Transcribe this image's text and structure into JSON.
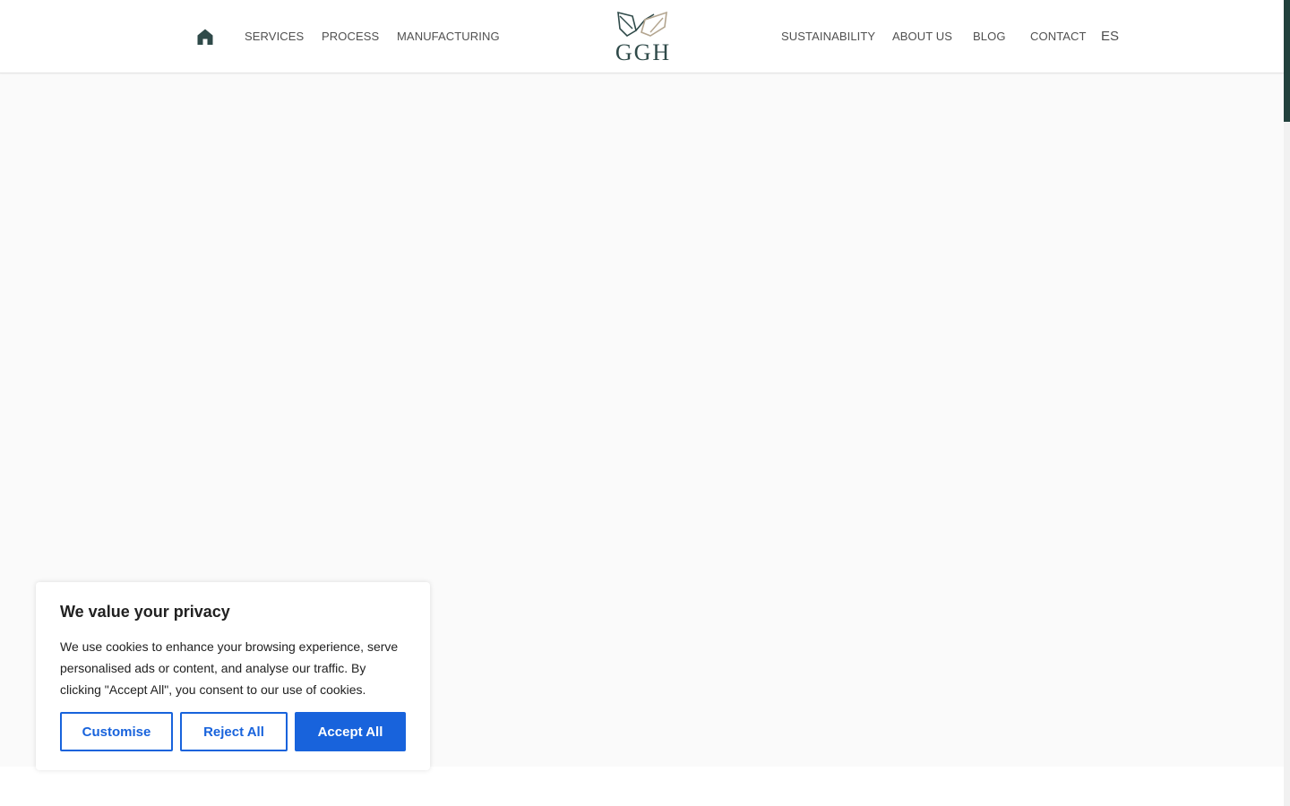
{
  "header": {
    "nav_left": [
      {
        "label": "SERVICES"
      },
      {
        "label": "PROCESS"
      },
      {
        "label": "MANUFACTURING"
      }
    ],
    "logo_text": "GGH",
    "nav_right": [
      {
        "label": "SUSTAINABILITY"
      },
      {
        "label": "ABOUT US"
      },
      {
        "label": "BLOG"
      },
      {
        "label": "CONTACT"
      }
    ],
    "language": "ES"
  },
  "icons": {
    "home": "home-icon",
    "logo": "leaf-logo-icon"
  },
  "cookie_banner": {
    "title": "We value your privacy",
    "text": "We use cookies to enhance your browsing experience, serve personalised ads or content, and analyse our traffic. By clicking \"Accept All\", you consent to our use of cookies.",
    "buttons": {
      "customise": "Customise",
      "reject": "Reject All",
      "accept": "Accept All"
    }
  },
  "colors": {
    "brand_dark": "#2f4a49",
    "logo_accent": "#b3a58f",
    "cookie_accent": "#1863dc",
    "scroll_thumb": "#22413d"
  }
}
